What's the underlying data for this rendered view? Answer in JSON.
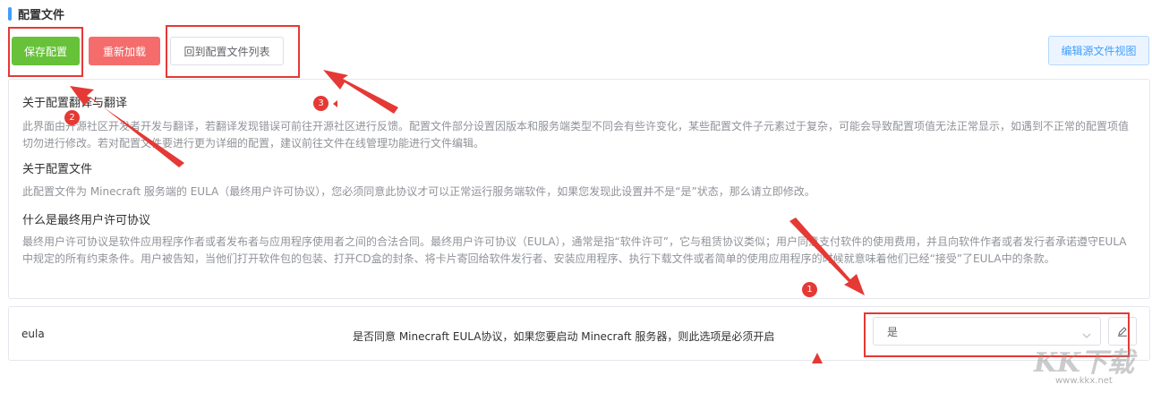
{
  "header": {
    "title": "配置文件"
  },
  "toolbar": {
    "save_label": "保存配置",
    "reload_label": "重新加载",
    "back_label": "回到配置文件列表",
    "source_label": "编辑源文件视图"
  },
  "info": {
    "sections": [
      {
        "title": "关于配置翻译与翻译",
        "text": "此界面由开源社区开发者开发与翻译，若翻译发现错误可前往开源社区进行反馈。配置文件部分设置因版本和服务端类型不同会有些许变化，某些配置文件子元素过于复杂，可能会导致配置项值无法正常显示，如遇到不正常的配置项值切勿进行修改。若对配置文件要进行更为详细的配置，建议前往文件在线管理功能进行文件编辑。"
      },
      {
        "title": "关于配置文件",
        "text": "此配置文件为 Minecraft 服务端的 EULA（最终用户许可协议），您必须同意此协议才可以正常运行服务端软件，如果您发现此设置并不是“是”状态，那么请立即修改。"
      },
      {
        "title": "什么是最终用户许可协议",
        "text": "最终用户许可协议是软件应用程序作者或者发布者与应用程序使用者之间的合法合同。最终用户许可协议（EULA），通常是指“软件许可”，它与租赁协议类似；用户同意支付软件的使用费用，并且向软件作者或者发行者承诺遵守EULA中规定的所有约束条件。用户被告知，当他们打开软件包的包装、打开CD盒的封条、将卡片寄回给软件发行者、安装应用程序、执行下载文件或者简单的使用应用程序的时候就意味着他们已经“接受”了EULA中的条款。"
      }
    ]
  },
  "eula": {
    "key": "eula",
    "description": "是否同意 Minecraft EULA协议，如果您要启动 Minecraft 服务器，则此选项是必须开启",
    "selected": "是"
  },
  "annotations": {
    "badges": [
      "1",
      "2",
      "3"
    ],
    "color": "#e53935"
  },
  "watermark": {
    "logo": "KK下载",
    "url": "www.kkx.net"
  },
  "colors": {
    "primary": "#409eff",
    "success": "#67c23a",
    "danger": "#f56c6c",
    "muted_text": "#909399",
    "border": "#e4e7ed"
  },
  "icons": {
    "select_chevron": "chevron-down-icon",
    "edit": "edit-pen-icon"
  }
}
